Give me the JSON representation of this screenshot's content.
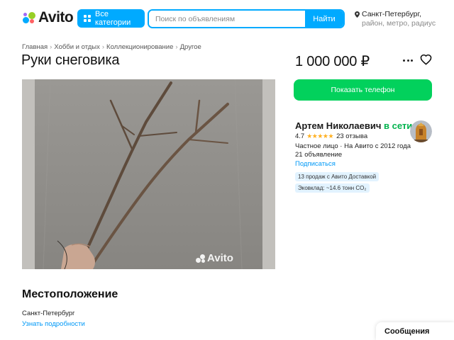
{
  "header": {
    "logo_text": "Avito",
    "categories_label": "Все категории",
    "search_placeholder": "Поиск по объявлениям",
    "search_button": "Найти",
    "location_city": "Санкт-Петербург,",
    "location_sub": "район, метро, радиус"
  },
  "breadcrumbs": [
    "Главная",
    "Хобби и отдых",
    "Коллекционирование",
    "Другое"
  ],
  "listing": {
    "title": "Руки снеговика",
    "price": "1 000 000 ₽",
    "photo_watermark": "Avito"
  },
  "seller": {
    "phone_button": "Показать телефон",
    "name": "Артем Николаевич",
    "online": "в сети",
    "rating": "4.7",
    "stars": 4.7,
    "reviews": "23 отзыва",
    "meta": "Частное лицо · На Авито с 2012 года",
    "ads_count": "21 объявление",
    "subscribe": "Подписаться",
    "badge_delivery": "13 продаж с Авито Доставкой",
    "badge_eco": "Эковклад: ~14.6 тонн CO₂"
  },
  "location_section": {
    "title": "Местоположение",
    "city": "Санкт-Петербург",
    "more_link": "Узнать подробности"
  },
  "messages_label": "Сообщения",
  "colors": {
    "accent_blue": "#00aaff",
    "phone_green": "#02d15c",
    "online_green": "#02b34e",
    "link_blue": "#0099f7",
    "star_yellow": "#ffb021"
  }
}
